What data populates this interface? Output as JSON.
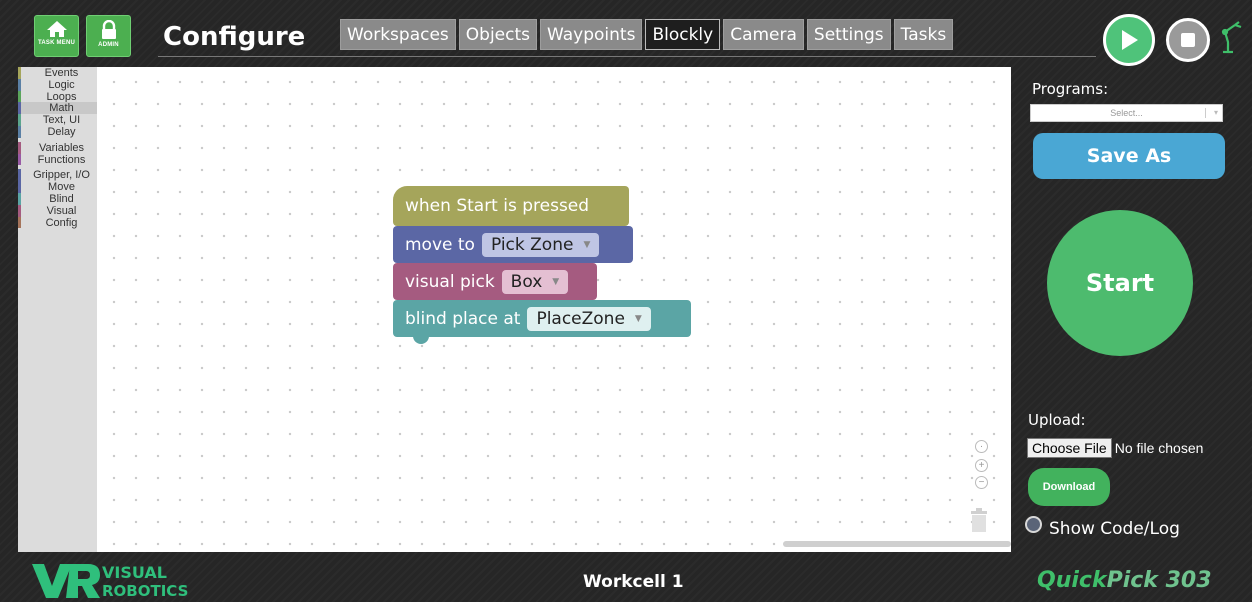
{
  "header": {
    "task_menu_label": "TASK MENU",
    "admin_label": "ADMIN",
    "title": "Configure",
    "tabs": [
      {
        "label": "Workspaces"
      },
      {
        "label": "Objects"
      },
      {
        "label": "Waypoints"
      },
      {
        "label": "Blockly",
        "active": true
      },
      {
        "label": "Camera"
      },
      {
        "label": "Settings"
      },
      {
        "label": "Tasks"
      }
    ],
    "icons": {
      "play": "play-icon",
      "stop": "stop-icon",
      "robot": "robot-arm-icon",
      "home": "home-icon",
      "lock": "lock-icon"
    }
  },
  "toolbox": {
    "categories": [
      {
        "label": "Events",
        "color": "#a5a55b"
      },
      {
        "label": "Logic",
        "color": "#5b80a5"
      },
      {
        "label": "Loops",
        "color": "#5ba55b"
      },
      {
        "label": "Math",
        "color": "#5b67a5"
      },
      {
        "label": "Text, UI",
        "color": "#5ba58c"
      },
      {
        "label": "Delay",
        "color": "#5b80a5"
      },
      {
        "label": "Variables",
        "color": "#a55b80"
      },
      {
        "label": "Functions",
        "color": "#995ba5"
      },
      {
        "label": "Gripper, I/O",
        "color": "#5b67a5"
      },
      {
        "label": "Move",
        "color": "#5b67a5"
      },
      {
        "label": "Blind",
        "color": "#5ba5a5"
      },
      {
        "label": "Visual",
        "color": "#a55b80"
      },
      {
        "label": "Config",
        "color": "#a5745b"
      }
    ]
  },
  "blocks": {
    "event": {
      "text": "when Start is pressed",
      "color": "#a5a55b"
    },
    "move": {
      "text": "move to",
      "value": "Pick Zone",
      "color": "#5b67a5"
    },
    "visual": {
      "text": "visual pick",
      "value": "Box",
      "color": "#a55b80"
    },
    "blind": {
      "text": "blind place at",
      "value": "PlaceZone",
      "color": "#5ba5a5"
    }
  },
  "right_panel": {
    "programs_label": "Programs:",
    "programs_placeholder": "Select...",
    "save_as_label": "Save As",
    "start_label": "Start",
    "upload_label": "Upload:",
    "choose_file_label": "Choose File",
    "no_file_text": "No file chosen",
    "download_label": "Download",
    "show_code_label": "Show Code/Log"
  },
  "footer": {
    "logo_line1": "VISUAL",
    "logo_line2": "ROBOTICS",
    "workcell": "Workcell 1",
    "product_part1": "Quick",
    "product_part2": "Pick 303",
    "colors": {
      "product_part1": "#3fbf6a",
      "product_part2": "#6fc38e",
      "logo": "#2fbf7c"
    }
  }
}
